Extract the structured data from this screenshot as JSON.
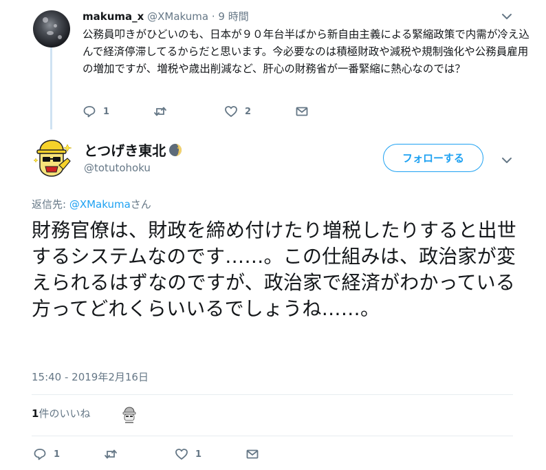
{
  "reply_tweet": {
    "name": "makuma_x",
    "handle": "@XMakuma",
    "separator": "·",
    "time": "9 時間",
    "text": "公務員叩きがひどいのも、日本が９０年台半ばから新自由主義による緊縮政策で内需が冷え込んで経済停滞してるからだと思います。今必要なのは積極財政や減税や規制強化や公務員雇用の増加ですが、増税や歳出削減など、肝心の財務省が一番緊縮に熱心なのでは？",
    "reply_count": "1",
    "retweet_count": "",
    "like_count": "2",
    "icons": [
      "reply-icon",
      "retweet-icon",
      "like-icon",
      "message-icon",
      "chevron-down-icon"
    ]
  },
  "main_tweet": {
    "name": "とつげき東北",
    "handle": "@totutohoku",
    "follow_label": "フォローする",
    "replying_prefix": "返信先: ",
    "replying_link": "@XMakuma",
    "replying_suffix": "さん",
    "text": "財務官僚は、財政を締め付けたり増税したりすると出世するシステムなのです……。この仕組みは、政治家が変えられるはずなのですが、政治家で経済がわかっている方ってどれくらいいるでしょうね……。",
    "timestamp": "15:40 - 2019年2月16日",
    "likes_count": "1",
    "likes_label": "件のいいね",
    "reply_count": "1",
    "retweet_count": "",
    "like_count": "1",
    "colors": {
      "accent": "#1da1f2",
      "muted": "#657786",
      "text": "#14171a",
      "thread": "#cfe2f2"
    }
  }
}
